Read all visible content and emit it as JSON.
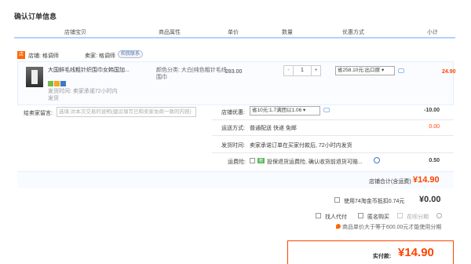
{
  "page_title": "确认订单信息",
  "columns": {
    "shop_item": "店铺宝贝",
    "attributes": "商品属性",
    "unit_price": "单价",
    "quantity": "数量",
    "promotion": "优惠方式",
    "subtotal": "小计"
  },
  "shop": {
    "icon_text": "店",
    "shop_label": "店铺: 格调师",
    "seller_label": "卖家: 格调师",
    "contact_label": "和我联系"
  },
  "item": {
    "title": "大国鲜毛线粗针织围巾女韩国加...",
    "attributes": "颜色分类: 大白|纯色粗针毛线围巾",
    "shipping_note": "发货时间: 卖家承诺72小时内发货",
    "price": "283.00",
    "qty_minus": "-",
    "qty_value": "1",
    "qty_plus": "+",
    "promotion_selected": "省258.10元:出口原 ▾",
    "subtotal": "24.90"
  },
  "message": {
    "label": "给卖家留言:",
    "placeholder": "选填:对本次交易的说明(建议填写已和卖家协商一致的内容)"
  },
  "store_coupon": {
    "label": "店铺优惠:",
    "selected": "省10元:1.7满团以1.06 ▾",
    "value": "-10.00"
  },
  "delivery": {
    "label": "运送方式:",
    "method": "普通配送 快递 免邮",
    "value": "0.00"
  },
  "ship_time": {
    "label": "发货时间:",
    "text": "卖家承诺订单在买家付款后, 72小时内发货"
  },
  "insurance": {
    "label": "运费险:",
    "tag": "赠",
    "text": "投保退货运费险, 确认收货前退货可赔...",
    "value": "0.50"
  },
  "shop_total": {
    "label": "店铺合计(含运费)",
    "value": "¥14.90"
  },
  "coins": {
    "text": "使用74淘金币抵扣0.74元",
    "value": "¥0.00"
  },
  "options": {
    "proxy": "找人代付",
    "anonymous": "匿名购买",
    "installment": "花呗分期",
    "installment_note": "商品单价大于等于600.00元才能使用分期"
  },
  "final": {
    "label": "实付款:",
    "value": "¥14.90"
  },
  "colors": {
    "accent": "#ff4400",
    "link": "#3c78c8",
    "header_border": "#b2d1ff"
  }
}
